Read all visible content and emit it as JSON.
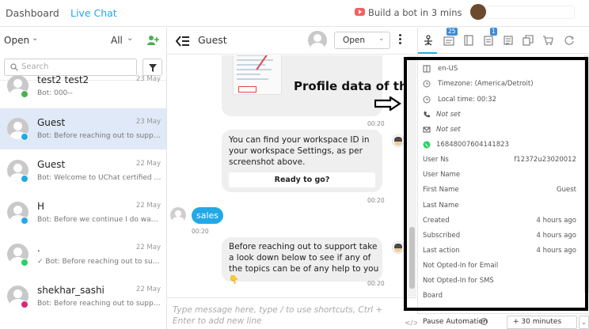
{
  "topbar": {
    "dashboard": "Dashboard",
    "live_chat": "Live Chat",
    "bot_cta": "Build a bot in 3 mins"
  },
  "left": {
    "status_filter": "Open",
    "assign_filter": "All",
    "search_placeholder": "Search",
    "conversations": [
      {
        "name": "test2 test2",
        "date": "23 May",
        "preview": "Bot: 000--",
        "channel_color": "#4caf50",
        "active": false
      },
      {
        "name": "Guest",
        "date": "23 May",
        "preview": "Bot: Before reaching out to support t...",
        "channel_color": "#23a8e6",
        "active": true
      },
      {
        "name": "Guest",
        "date": "22 May",
        "preview": "Bot: Welcome to UChat certified Chat...",
        "channel_color": "#23a8e6",
        "active": false
      },
      {
        "name": "H",
        "date": "22 May",
        "preview": "Bot: Before we continue I do want to ...",
        "channel_color": "#23a8e6",
        "active": false
      },
      {
        "name": ".",
        "date": "22 May",
        "preview": "✓ Bot: Before reaching out to suppo...",
        "channel_color": "#25d366",
        "active": false
      },
      {
        "name": "shekhar_sashi",
        "date": "22 May",
        "preview": "Bot: Before reaching out to suppo...",
        "channel_color": "#d62976",
        "active": false
      }
    ]
  },
  "chat": {
    "contact_name": "Guest",
    "status": "Open",
    "overlay_title": "Profile data of the User",
    "messages": {
      "time_1": "00:20",
      "card_text": "You can find your workspace ID in your workspace Settings, as per screenshot above.",
      "card_button": "Ready to go?",
      "time_2": "00:20",
      "user_text": "sales",
      "time_3": "00:20",
      "support_text": "Before reaching out to support take a look down below to see if any of the topics can be of any help to you 👇",
      "time_4": "00:20"
    },
    "composer_placeholder": "Type message here, type / to use shortcuts, Ctrl + Enter to add new line"
  },
  "right": {
    "tab_counts": {
      "inbox": "25",
      "notes": "1"
    },
    "profile": {
      "locale": "en-US",
      "timezone": "Timezone: (America/Detroit)",
      "local_time": "Local time: 00:32",
      "phone": "Not set",
      "email": "Not set",
      "whatsapp_id": "16848007604141823"
    },
    "fields": [
      {
        "label": "User Ns",
        "value": "f12372u23020012"
      },
      {
        "label": "User Name",
        "value": ""
      },
      {
        "label": "First Name",
        "value": "Guest"
      },
      {
        "label": "Last Name",
        "value": ""
      },
      {
        "label": "Created",
        "value": "4 hours ago"
      },
      {
        "label": "Subscribed",
        "value": "4 hours ago"
      },
      {
        "label": "Last action",
        "value": "4 hours ago"
      },
      {
        "label": "Not Opted-In for Email",
        "value": ""
      },
      {
        "label": "Not Opted-In for SMS",
        "value": ""
      },
      {
        "label": "Board",
        "value": ""
      }
    ],
    "pause_label": "Pause Automation",
    "pause_value": "+ 30 minutes"
  }
}
